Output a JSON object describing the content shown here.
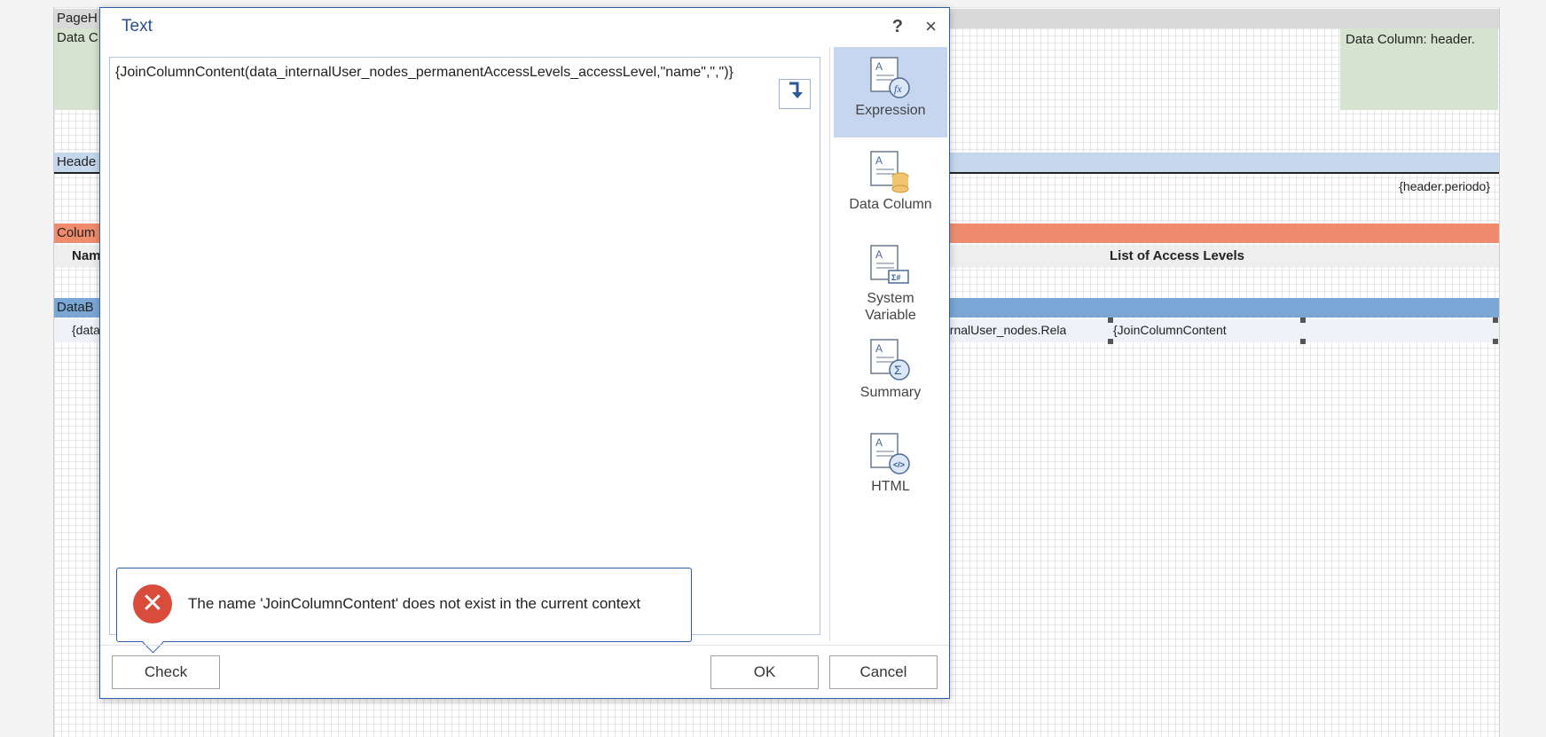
{
  "canvas": {
    "bands": {
      "page_header": "PageH",
      "data_column_left": "Data C",
      "data_column_right": "Data Column: header.",
      "header": "Heade",
      "header_period": "{header.periodo}",
      "column_header": "Colum",
      "name_col": "Nam",
      "list_col": "List of Access Levels",
      "data_band": "DataB",
      "data_cell_left": "{data",
      "data_cell_mid": "ernalUser_nodes.Rela",
      "data_cell_right": "{JoinColumnContent"
    },
    "colors": {
      "page_header_band": "#d9d9d9",
      "data_column_band": "#d6e3d0",
      "header_band": "#c5d7ec",
      "column_header_band": "#f08c6e",
      "data_band": "#7ba7d6"
    }
  },
  "dialog": {
    "title": "Text",
    "help_label": "?",
    "close_label": "×",
    "expression_text": "{JoinColumnContent(data_internalUser_nodes_permanentAccessLevels_accessLevel,\"name\",\",\")}",
    "insert_icon": "arrow-insert-icon",
    "sidebar": [
      {
        "label": "Expression",
        "icon": "expression-icon",
        "active": true
      },
      {
        "label": "Data Column",
        "icon": "data-column-icon",
        "active": false
      },
      {
        "label": "System Variable",
        "icon": "system-variable-icon",
        "active": false
      },
      {
        "label": "Summary",
        "icon": "summary-icon",
        "active": false
      },
      {
        "label": "HTML",
        "icon": "html-icon",
        "active": false
      }
    ],
    "error": {
      "icon": "error-icon",
      "message": "The name 'JoinColumnContent' does not exist in the current context"
    },
    "buttons": {
      "check": "Check",
      "ok": "OK",
      "cancel": "Cancel"
    }
  }
}
